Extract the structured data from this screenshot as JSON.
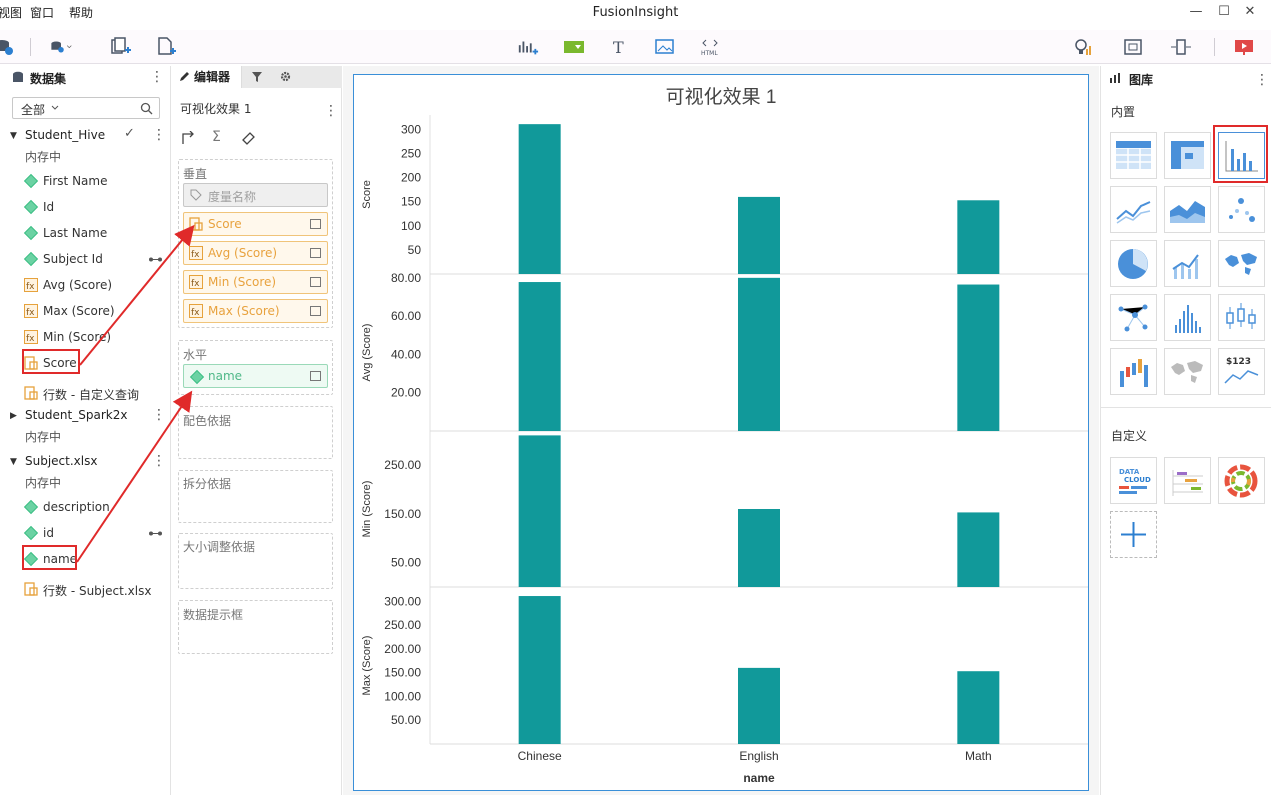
{
  "menu": [
    "视图",
    "窗口",
    "帮助"
  ],
  "app_title": "FusionInsight",
  "left_panel": {
    "title": "数据集",
    "filter_label": "全部",
    "datasets": [
      {
        "name": "Student_Hive",
        "status": "内存中",
        "fields": [
          {
            "label": "First Name",
            "kind": "dimension"
          },
          {
            "label": "Id",
            "kind": "dimension"
          },
          {
            "label": "Last Name",
            "kind": "dimension"
          },
          {
            "label": "Subject Id",
            "kind": "dimension"
          },
          {
            "label": "Avg (Score)",
            "kind": "calc"
          },
          {
            "label": "Max (Score)",
            "kind": "calc"
          },
          {
            "label": "Min (Score)",
            "kind": "calc"
          },
          {
            "label": "Score",
            "kind": "measure"
          },
          {
            "label": "行数 - 自定义查询",
            "kind": "measure"
          }
        ]
      },
      {
        "name": "Student_Spark2x",
        "status": "内存中"
      },
      {
        "name": "Subject.xlsx",
        "status": "内存中",
        "fields": [
          {
            "label": "description",
            "kind": "dimension"
          },
          {
            "label": "id",
            "kind": "dimension"
          },
          {
            "label": "name",
            "kind": "dimension"
          },
          {
            "label": "行数 - Subject.xlsx",
            "kind": "measure"
          }
        ]
      }
    ]
  },
  "editor": {
    "tab_label": "编辑器",
    "viz_name": "可视化效果 1",
    "vertical_label": "垂直",
    "vertical_items": [
      "度量名称",
      "Score",
      "Avg (Score)",
      "Min (Score)",
      "Max (Score)"
    ],
    "horizontal_label": "水平",
    "horizontal_items": [
      "name"
    ],
    "color_label": "配色依据",
    "split_label": "拆分依据",
    "size_label": "大小调整依据",
    "tooltip_label": "数据提示框"
  },
  "gallery": {
    "title": "图库",
    "builtin_label": "内置",
    "custom_label": "自定义",
    "kpi_text": "$123",
    "data_cloud_line1": "DATA",
    "data_cloud_line2": "CLOUD"
  },
  "chart_data": {
    "type": "bar",
    "title": "可视化效果 1",
    "categories": [
      "Chinese",
      "English",
      "Math"
    ],
    "xlabel": "name",
    "bar_color": "#11999a",
    "series": [
      {
        "name": "Score",
        "values": [
          311,
          160,
          153
        ],
        "ylim": [
          0,
          330
        ],
        "ticks": [
          "50",
          "100",
          "150",
          "200",
          "250",
          "300"
        ],
        "tick_values": [
          50,
          100,
          150,
          200,
          250,
          300
        ]
      },
      {
        "name": "Avg (Score)",
        "values": [
          77.8,
          80.0,
          76.5
        ],
        "ylim": [
          0,
          82
        ],
        "ticks": [
          "20.00",
          "40.00",
          "60.00",
          "80.00"
        ],
        "tick_values": [
          20,
          40,
          60,
          80
        ]
      },
      {
        "name": "Min (Score)",
        "values": [
          311,
          160,
          153
        ],
        "ylim": [
          0,
          320
        ],
        "ticks": [
          "50.00",
          "150.00",
          "250.00"
        ],
        "tick_values": [
          50,
          150,
          250
        ]
      },
      {
        "name": "Max (Score)",
        "values": [
          311,
          160,
          153
        ],
        "ylim": [
          0,
          330
        ],
        "ticks": [
          "50.00",
          "100.00",
          "150.00",
          "200.00",
          "250.00",
          "300.00"
        ],
        "tick_values": [
          50,
          100,
          150,
          200,
          250,
          300
        ]
      }
    ]
  }
}
